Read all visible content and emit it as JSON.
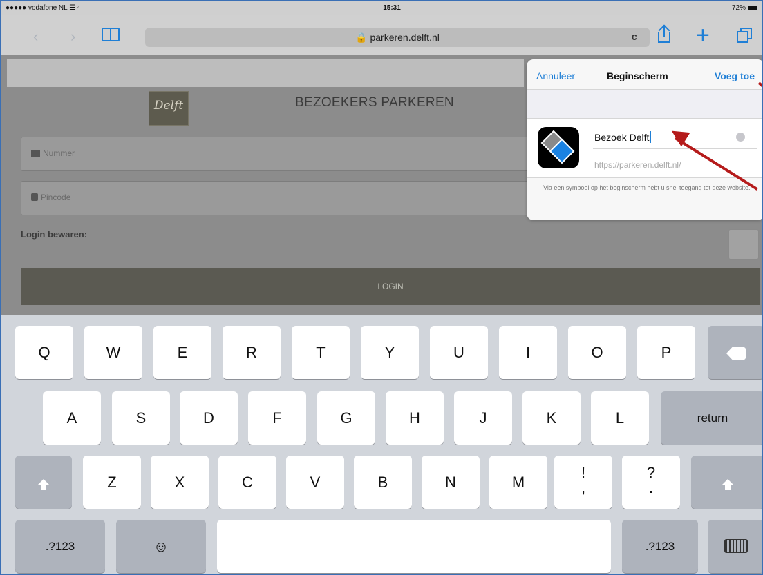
{
  "status_bar": {
    "carrier": "●●●●● vodafone NL ☰ ◦",
    "time": "15:31",
    "battery": "72%"
  },
  "toolbar": {
    "url": "parkeren.delft.nl",
    "reload_icon": "c",
    "back_icon": "‹",
    "forward_icon": "›",
    "plus_icon": "+"
  },
  "page": {
    "logo_text": "Delft",
    "title": "BEZOEKERS PARKEREN",
    "number_placeholder": "Nummer",
    "pincode_placeholder": "Pincode",
    "login_remember_label": "Login bewaren:",
    "login_button": "LOGIN"
  },
  "popover": {
    "cancel": "Annuleer",
    "title": "Beginscherm",
    "add": "Voeg toe",
    "name_value": "Bezoek Delft",
    "url": "https://parkeren.delft.nl/",
    "footer": "Via een symbool op het beginscherm hebt u snel toegang tot deze website."
  },
  "keyboard": {
    "row1": [
      "Q",
      "W",
      "E",
      "R",
      "T",
      "Y",
      "U",
      "I",
      "O",
      "P"
    ],
    "row2": [
      "A",
      "S",
      "D",
      "F",
      "G",
      "H",
      "J",
      "K",
      "L"
    ],
    "row3": [
      "Z",
      "X",
      "C",
      "V",
      "B",
      "N",
      "M"
    ],
    "return": "return",
    "num_left": ".?123",
    "num_right": ".?123",
    "emoji": "☺",
    "exclaim": "!",
    "comma": ",",
    "question": "?",
    "period": "."
  },
  "colors": {
    "accent": "#1f7fd6",
    "annotation": "#b51b1b",
    "login_button": "#5b5a52"
  }
}
